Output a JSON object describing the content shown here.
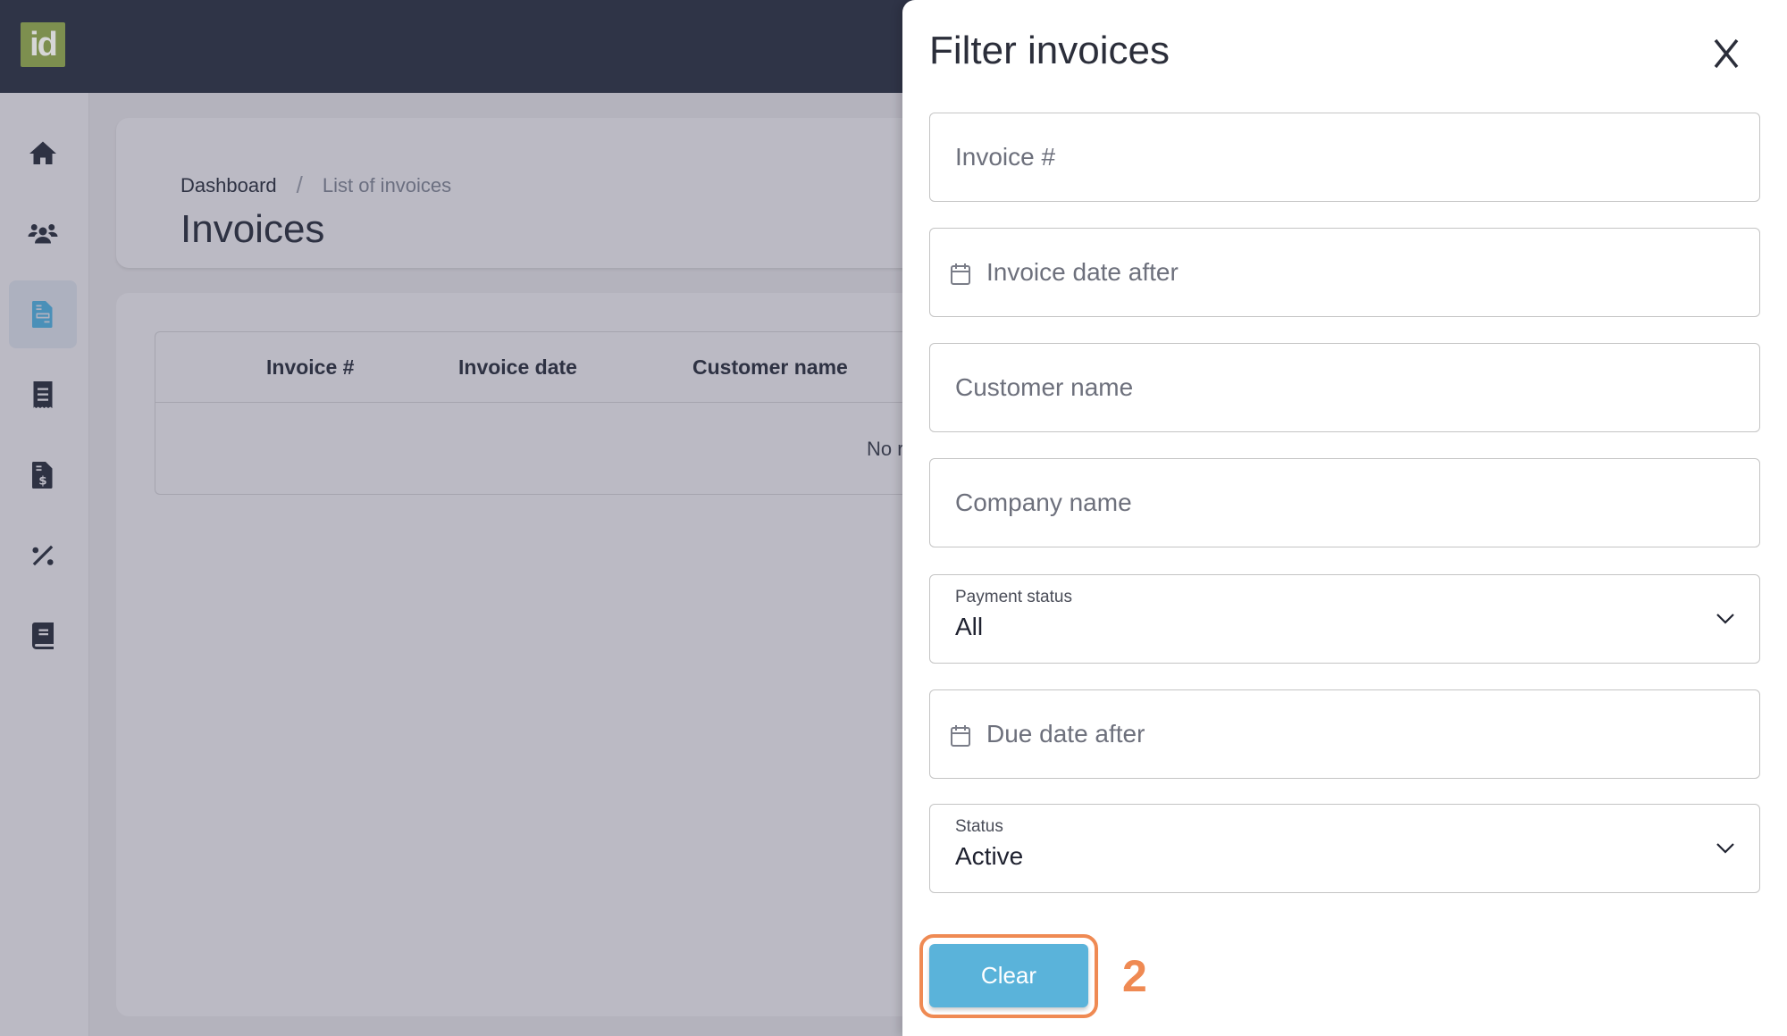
{
  "app": {
    "logo_text": "id"
  },
  "sidebar": {
    "items": [
      {
        "icon": "home-icon",
        "label": "Home",
        "active": false
      },
      {
        "icon": "users-icon",
        "label": "Customers",
        "active": false
      },
      {
        "icon": "invoice-icon",
        "label": "Invoices",
        "active": true
      },
      {
        "icon": "receipt-icon",
        "label": "Receipts",
        "active": false
      },
      {
        "icon": "dollar-document-icon",
        "label": "Payments",
        "active": false
      },
      {
        "icon": "percent-icon",
        "label": "Taxes",
        "active": false
      },
      {
        "icon": "book-icon",
        "label": "Catalog",
        "active": false
      }
    ],
    "active_color": "#4a90b8"
  },
  "header": {
    "breadcrumb": {
      "home": "Dashboard",
      "separator": "/",
      "current": "List of invoices"
    },
    "title": "Invoices"
  },
  "table": {
    "columns": [
      "Invoice #",
      "Invoice date",
      "Customer name"
    ],
    "empty_message": "No r"
  },
  "filter_panel": {
    "title": "Filter invoices",
    "close_label": "X",
    "fields": {
      "invoice_number": {
        "placeholder": "Invoice #",
        "value": ""
      },
      "invoice_date_after": {
        "placeholder": "Invoice date after",
        "value": "",
        "icon": "calendar-icon"
      },
      "customer_name": {
        "placeholder": "Customer name",
        "value": ""
      },
      "company_name": {
        "placeholder": "Company name",
        "value": ""
      },
      "payment_status": {
        "label": "Payment status",
        "value": "All"
      },
      "due_date_after": {
        "placeholder": "Due date after",
        "value": "",
        "icon": "calendar-icon"
      },
      "status": {
        "label": "Status",
        "value": "Active"
      }
    },
    "clear_label": "Clear"
  },
  "annotation": {
    "step_number": "2",
    "color": "#ef8a53"
  }
}
